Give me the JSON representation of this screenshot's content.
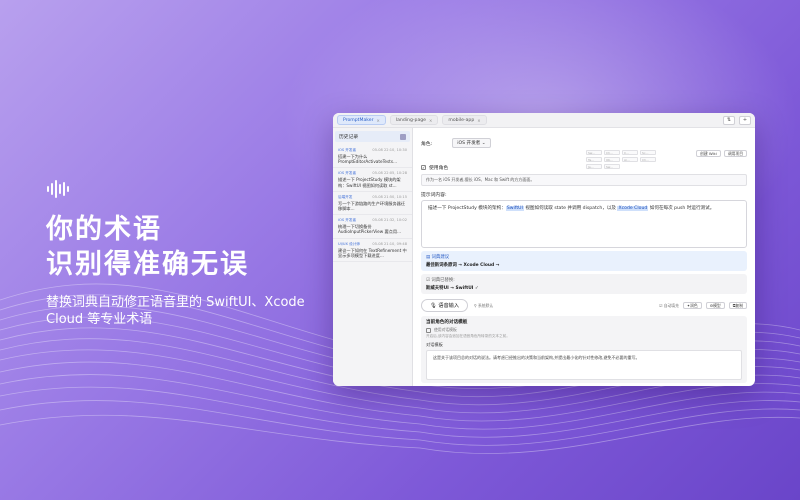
{
  "marketing": {
    "headline_line1": "你的术语",
    "headline_line2": "识别得准确无误",
    "subline": "替换词典自动修正语音里的 SwiftUI、Xcode Cloud 等专业术语"
  },
  "window": {
    "tabs": [
      {
        "label": "PromptMaker",
        "active": true
      },
      {
        "label": "landing-page",
        "active": false
      },
      {
        "label": "mobile-app",
        "active": false
      }
    ],
    "close_glyph": "×",
    "sort_icon": "⇅",
    "add_icon": "+"
  },
  "sidebar": {
    "title": "历史记录",
    "items": [
      {
        "tag": "iOS 开发者",
        "date": "05-08 22:10, 10:30",
        "text": "搭建一下为什么 PromptEditorActivateTests..."
      },
      {
        "tag": "iOS 开发者",
        "date": "05-08 22:05, 10:28",
        "text": "描述一下 ProjectStudy 模块的架构：SwiftUI 视图如何读取 st..."
      },
      {
        "tag": "后端开发",
        "date": "05-08 21:50, 10:15",
        "text": "写一个下游链路的生产环境服务器迁移脚本..."
      },
      {
        "tag": "iOS 开发者",
        "date": "05-08 21:32, 10:02",
        "text": "梳理一下切换备份 AudioInputPickerView 要点用..."
      },
      {
        "tag": "UI/UX 设计师",
        "date": "05-08 21:10, 09:48",
        "text": "建议一下如何在 TextRefinement 中显示多项模型下载进度..."
      }
    ]
  },
  "main": {
    "role_label": "角色:",
    "role_value": "iOS 开发者",
    "mini_options": [
      "Sw...",
      "Ch...",
      "C...",
      "Sc...",
      "Te...",
      "Ob...",
      "Ai...",
      "Ch...",
      "Ja...",
      "Sw..."
    ],
    "create_btn": "创建 Wiki",
    "refine_btn": "调用项目",
    "use_role_label": "使用角色",
    "role_desc": "作为一名 iOS 开发者,擅长 iOS、Mac 和 Swift 的方方面面。",
    "prompt_label": "提示词内容:",
    "prompt_before": "描述一下 ProjectStudy 模块的架构：",
    "prompt_hl1": "SwiftUI",
    "prompt_mid": " 视图如何读取 state 并调用 dispatch，以及 ",
    "prompt_hl2": "Xcode Cloud",
    "prompt_after": " 如何在每次 push 时运行测试。",
    "sugg1_title": "词典建议",
    "sugg1_value": "最佳新词条原词 → Xcode Cloud →",
    "sugg2_title": "词典已替换:",
    "sugg2_value": "斯威夫特UI → SwiftUI ✓",
    "voice_btn": "语音输入",
    "voice_hint": "系统默认",
    "opt_auto": "自动填充",
    "opt_polish": "润色",
    "opt_model": "模型",
    "opt_copy": "复制",
    "panel_title": "当前角色的对话模板",
    "panel_use": "使用对话模板",
    "panel_desc": "开启后,该内容会追加在语音角色所转录的文本之前。",
    "tmpl_label": "对话模板",
    "tmpl_text": "这是关于该项目总的对话的说法。请考虑已经推出的决策和当前架构,并提出最小化的针对性修改,避免不必要的重写。"
  }
}
